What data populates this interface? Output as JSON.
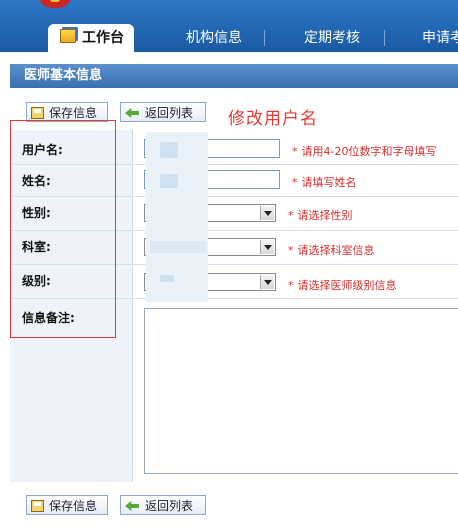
{
  "nav": {
    "tabs": [
      {
        "label": "工作台",
        "active": true
      },
      {
        "label": "机构信息"
      },
      {
        "label": "定期考核"
      },
      {
        "label": "申请考"
      }
    ]
  },
  "section": {
    "title": "医师基本信息"
  },
  "toolbar": {
    "save_label": "保存信息",
    "back_label": "返回列表"
  },
  "annotation": "修改用户名",
  "form": {
    "fields": [
      {
        "label": "用户名:",
        "hint": "请用4-20位数字和字母填写"
      },
      {
        "label": "姓名:",
        "hint": "请填写姓名"
      },
      {
        "label": "性别:",
        "hint": "请选择性别"
      },
      {
        "label": "科室:",
        "hint": "请选择科室信息"
      },
      {
        "label": "级别:",
        "hint": "请选择医师级别信息"
      },
      {
        "label": "信息备注:"
      }
    ],
    "required_mark": "*"
  },
  "colors": {
    "nav_blue": "#1a5aa3",
    "title_bar": "#4a7fc0",
    "hint_red": "#d32f2f",
    "annotation_red": "#e53935",
    "label_bg": "#eef3f9"
  }
}
